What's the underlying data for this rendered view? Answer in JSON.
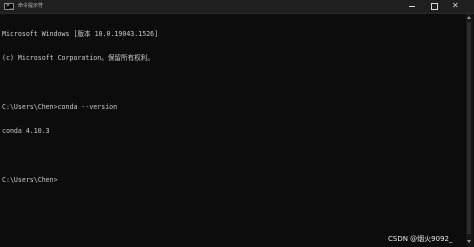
{
  "window": {
    "title": "命令提示符",
    "icon": "cmd-prompt-icon",
    "controls": {
      "minimize_icon": "minimize-icon",
      "maximize_icon": "maximize-icon",
      "close_icon": "close-icon",
      "close_glyph": "✕"
    }
  },
  "console": {
    "lines": [
      "Microsoft Windows [版本 10.0.19043.1526]",
      "(c) Microsoft Corporation。保留所有权利。",
      "",
      "C:\\Users\\Chen>conda --version",
      "conda 4.10.3",
      "",
      "C:\\Users\\Chen>"
    ],
    "text_color": "#cccccc",
    "background": "#0c0c0c"
  },
  "watermark": "CSDN @烟火9092_"
}
